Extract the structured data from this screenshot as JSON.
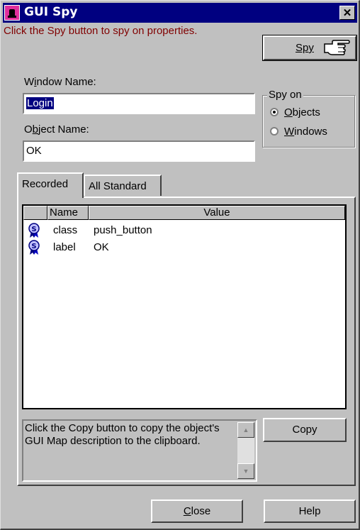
{
  "window": {
    "title": "GUI Spy",
    "close_symbol": "✕",
    "icon": "gui-spy-app-icon"
  },
  "instruction": "Click the Spy button to spy on properties.",
  "spy_button": {
    "label": "Spy",
    "icon": "pointing-hand-icon"
  },
  "window_name": {
    "label_pre": "W",
    "label_u": "i",
    "label_post": "ndow Name:",
    "value": "Login"
  },
  "object_name": {
    "label_pre": "O",
    "label_u": "b",
    "label_post": "ject Name:",
    "value": "OK"
  },
  "spy_on": {
    "legend": "Spy on",
    "options": [
      {
        "u": "O",
        "rest": "bjects",
        "selected": true
      },
      {
        "u": "W",
        "rest": "indows",
        "selected": false
      }
    ]
  },
  "tabs": [
    {
      "label": "Recorded",
      "active": true
    },
    {
      "label": "All Standard",
      "active": false
    }
  ],
  "properties": {
    "columns": [
      "Name",
      "Value"
    ],
    "rows": [
      {
        "icon": "property-ribbon-icon",
        "name": "class",
        "value": "push_button"
      },
      {
        "icon": "property-ribbon-icon",
        "name": "label",
        "value": "OK"
      }
    ]
  },
  "description": "Click the Copy button to copy the object's GUI Map description to the clipboard.",
  "buttons": {
    "copy": "Copy",
    "close_u": "C",
    "close_rest": "lose",
    "help": "Help"
  },
  "colors": {
    "titlebar": "#000080",
    "instruction_text": "#800000",
    "selection": "#000080",
    "face": "#c0c0c0"
  }
}
